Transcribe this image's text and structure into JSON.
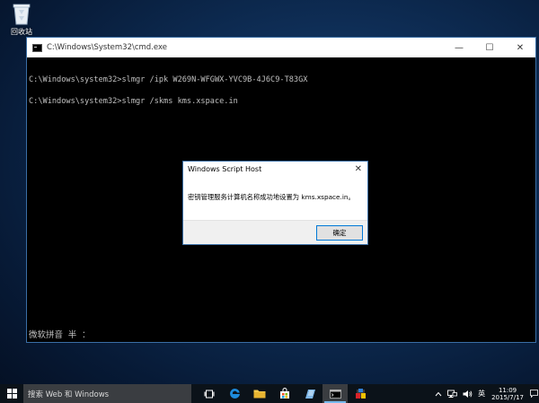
{
  "desktop": {
    "recycle_bin_label": "回收站"
  },
  "cmd_window": {
    "title": "C:\\Windows\\System32\\cmd.exe",
    "minimize": "—",
    "maximize": "☐",
    "close": "✕",
    "lines": [
      "C:\\Windows\\system32>slmgr /ipk W269N-WFGWX-YVC9B-4J6C9-T83GX",
      "C:\\Windows\\system32>slmgr /skms kms.xspace.in"
    ],
    "ime_status": "微软拼音 半 ："
  },
  "dialog": {
    "title": "Windows Script Host",
    "close": "✕",
    "message": "密钥管理服务计算机名称成功地设置为 kms.xspace.in。",
    "ok_label": "确定"
  },
  "taskbar": {
    "search_placeholder": "搜索 Web 和 Windows",
    "ime_lang": "英",
    "time": "11:09",
    "date": "2015/7/17"
  },
  "colors": {
    "accent": "#0078d7",
    "taskbar": "#0b1219",
    "search_box": "#3a3d41"
  }
}
